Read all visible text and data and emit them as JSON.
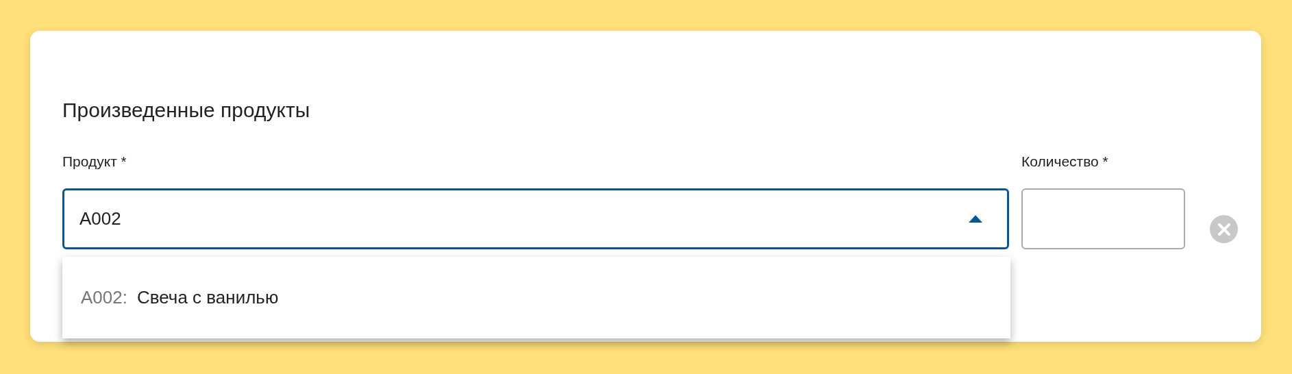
{
  "title": "Произведенные продукты",
  "product": {
    "label": "Продукт *",
    "value": "A002",
    "expanded": true,
    "options": [
      {
        "code": "A002:",
        "name": "Свеча с ванилью"
      }
    ]
  },
  "quantity": {
    "label": "Количество *"
  }
}
